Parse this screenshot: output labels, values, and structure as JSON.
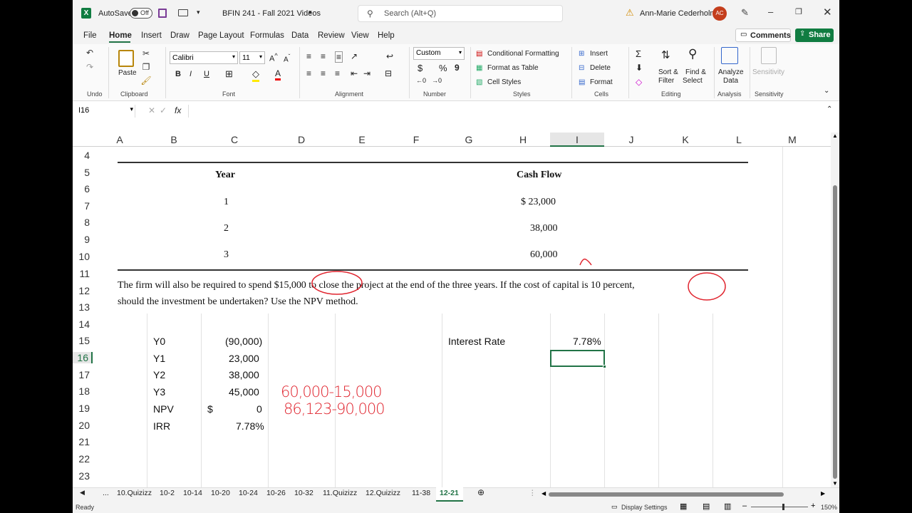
{
  "titlebar": {
    "autosave_label": "AutoSave",
    "autosave_state": "Off",
    "file_name": "BFIN 241 - Fall 2021 Videos",
    "search_placeholder": "Search (Alt+Q)",
    "user_name": "Ann-Marie Cederholm",
    "user_initials": "AC"
  },
  "menu": {
    "items": [
      "File",
      "Home",
      "Insert",
      "Draw",
      "Page Layout",
      "Formulas",
      "Data",
      "Review",
      "View",
      "Help"
    ],
    "active": "Home",
    "comments_label": "Comments",
    "share_label": "Share"
  },
  "ribbon": {
    "undo_label": "Undo",
    "clipboard_label": "Clipboard",
    "paste_label": "Paste",
    "font_name": "Calibri",
    "font_size": "11",
    "font_label": "Font",
    "bold": "B",
    "italic": "I",
    "underline": "U",
    "alignment_label": "Alignment",
    "number_format": "Custom",
    "number_label": "Number",
    "currency_symbol": "$",
    "percent_symbol": "%",
    "comma_symbol": "9",
    "conditional_formatting": "Conditional Formatting",
    "format_as_table": "Format as Table",
    "cell_styles": "Cell Styles",
    "styles_label": "Styles",
    "insert_label": "Insert",
    "delete_label": "Delete",
    "format_label": "Format",
    "cells_label": "Cells",
    "sort_filter": "Sort &",
    "sort_filter2": "Filter",
    "find_select": "Find &",
    "find_select2": "Select",
    "editing_label": "Editing",
    "analyze_data": "Analyze",
    "analyze_data2": "Data",
    "analysis_label": "Analysis",
    "sensitivity": "Sensitivity",
    "sensitivity_label": "Sensitivity"
  },
  "formula_bar": {
    "name_box": "I16",
    "fx": "fx",
    "content": ""
  },
  "columns": [
    "A",
    "B",
    "C",
    "D",
    "E",
    "F",
    "G",
    "H",
    "I",
    "J",
    "K",
    "L",
    "M"
  ],
  "rows": [
    "4",
    "5",
    "6",
    "7",
    "8",
    "9",
    "10",
    "11",
    "12",
    "13",
    "14",
    "15",
    "16",
    "17",
    "18",
    "19",
    "20",
    "21",
    "22",
    "23"
  ],
  "problem": {
    "year_header": "Year",
    "cf_header": "Cash Flow",
    "years": [
      "1",
      "2",
      "3"
    ],
    "cash_flows": [
      "$ 23,000",
      "38,000",
      "60,000"
    ],
    "text_line1": "The firm will also be required to spend $15,000 to close the project at the end of the three years. If the cost of capital is 10 percent,",
    "text_line2": "should the investment be undertaken? Use the NPV method."
  },
  "cells": {
    "labels": [
      "Y0",
      "Y1",
      "Y2",
      "Y3",
      "NPV",
      "IRR"
    ],
    "values": [
      "(90,000)",
      "23,000",
      "38,000",
      "45,000",
      "0",
      "7.78%"
    ],
    "npv_currency": "$",
    "interest_rate_label": "Interest Rate",
    "interest_rate_value": "7.78%"
  },
  "handwriting": {
    "line1": "60,000-15,000",
    "line2": "86,123-90,000"
  },
  "sheet_tabs": {
    "ellipsis": "...",
    "tabs": [
      "10.Quizizz",
      "10-2",
      "10-14",
      "10-20",
      "10-24",
      "10-26",
      "10-32",
      "11.Quizizz",
      "12.Quizizz",
      "11-38",
      "12-21"
    ],
    "active": "12-21"
  },
  "status": {
    "ready": "Ready",
    "display_settings": "Display Settings",
    "zoom": "150%"
  },
  "colors": {
    "excel_green": "#217346",
    "accent": "#107c41",
    "ink_red": "#e0242e",
    "avatar": "#c43e1c"
  }
}
